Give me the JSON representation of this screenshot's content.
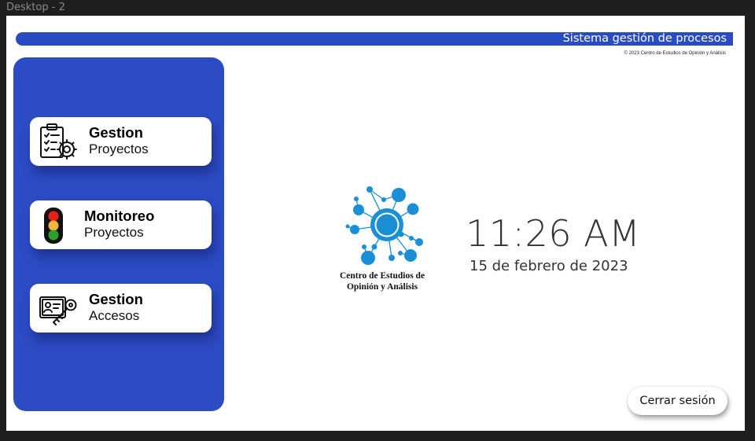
{
  "window": {
    "frame_label": "Desktop - 2"
  },
  "header": {
    "title": "Sistema gestión de procesos",
    "copyright": "© 2023 Centro de Estudios de Opinión y Análisis"
  },
  "sidebar": {
    "items": [
      {
        "line1": "Gestion",
        "line2": "Proyectos",
        "icon": "clipboard-gear-icon"
      },
      {
        "line1": "Monitoreo",
        "line2": "Proyectos",
        "icon": "traffic-light-icon"
      },
      {
        "line1": "Gestion",
        "line2": "Accesos",
        "icon": "id-card-key-icon"
      }
    ]
  },
  "main": {
    "logo": {
      "icon": "network-nodes-logo",
      "caption_line1": "Centro de Estudios de",
      "caption_line2": "Opinión y Análisis"
    },
    "clock": {
      "time": "11:26 AM",
      "date": "15 de febrero de 2023"
    },
    "logout_label": "Cerrar sesión"
  },
  "colors": {
    "brand_blue": "#2d4cc4",
    "logo_blue": "#1a8fd6",
    "traffic_red": "#e8201a",
    "traffic_amber": "#f5b43a",
    "traffic_green": "#2e9e2e"
  }
}
